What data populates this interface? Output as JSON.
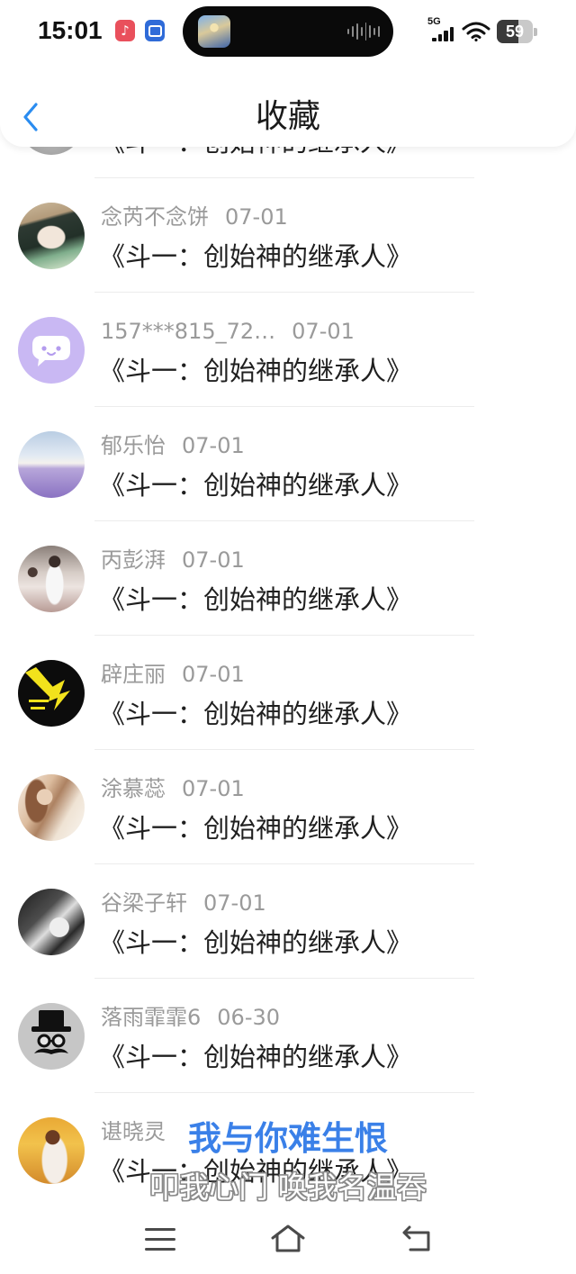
{
  "status_bar": {
    "time": "15:01",
    "network": "5G",
    "battery": "59",
    "battery_level": 59,
    "app_icons": [
      "douyin-icon",
      "cast-icon"
    ],
    "island": {
      "app_icon": "game-app-icon",
      "indicator": "audio-waveform-icon"
    },
    "signal_icon": "cellular-signal-icon",
    "wifi_icon": "wifi-icon"
  },
  "header": {
    "title": "收藏",
    "back_icon": "chevron-left-icon"
  },
  "list": {
    "items": [
      {
        "title": "《斗一：创始神的继承人》"
      },
      {
        "name": "念芮不念饼",
        "date": "07-01",
        "title": "《斗一：创始神的继承人》"
      },
      {
        "name": "157***815_72…",
        "date": "07-01",
        "title": "《斗一：创始神的继承人》"
      },
      {
        "name": "郁乐怡",
        "date": "07-01",
        "title": "《斗一：创始神的继承人》"
      },
      {
        "name": "丙彭湃",
        "date": "07-01",
        "title": "《斗一：创始神的继承人》"
      },
      {
        "name": "辟庄丽",
        "date": "07-01",
        "title": "《斗一：创始神的继承人》"
      },
      {
        "name": "涂慕蕊",
        "date": "07-01",
        "title": "《斗一：创始神的继承人》"
      },
      {
        "name": "谷梁子轩",
        "date": "07-01",
        "title": "《斗一：创始神的继承人》"
      },
      {
        "name": "落雨霏霏6",
        "date": "06-30",
        "title": "《斗一：创始神的继承人》"
      },
      {
        "name": "谌晓灵",
        "title": "《斗一：创始神的继承人》"
      }
    ]
  },
  "subtitles": {
    "line1": "我与你难生恨",
    "line2": "叩我心门 唤我名温吞"
  },
  "nav": {
    "icons": [
      "menu-icon",
      "home-icon",
      "back-icon"
    ]
  },
  "colors": {
    "accent": "#2a8cf0",
    "subtitle": "#3a80e8"
  }
}
